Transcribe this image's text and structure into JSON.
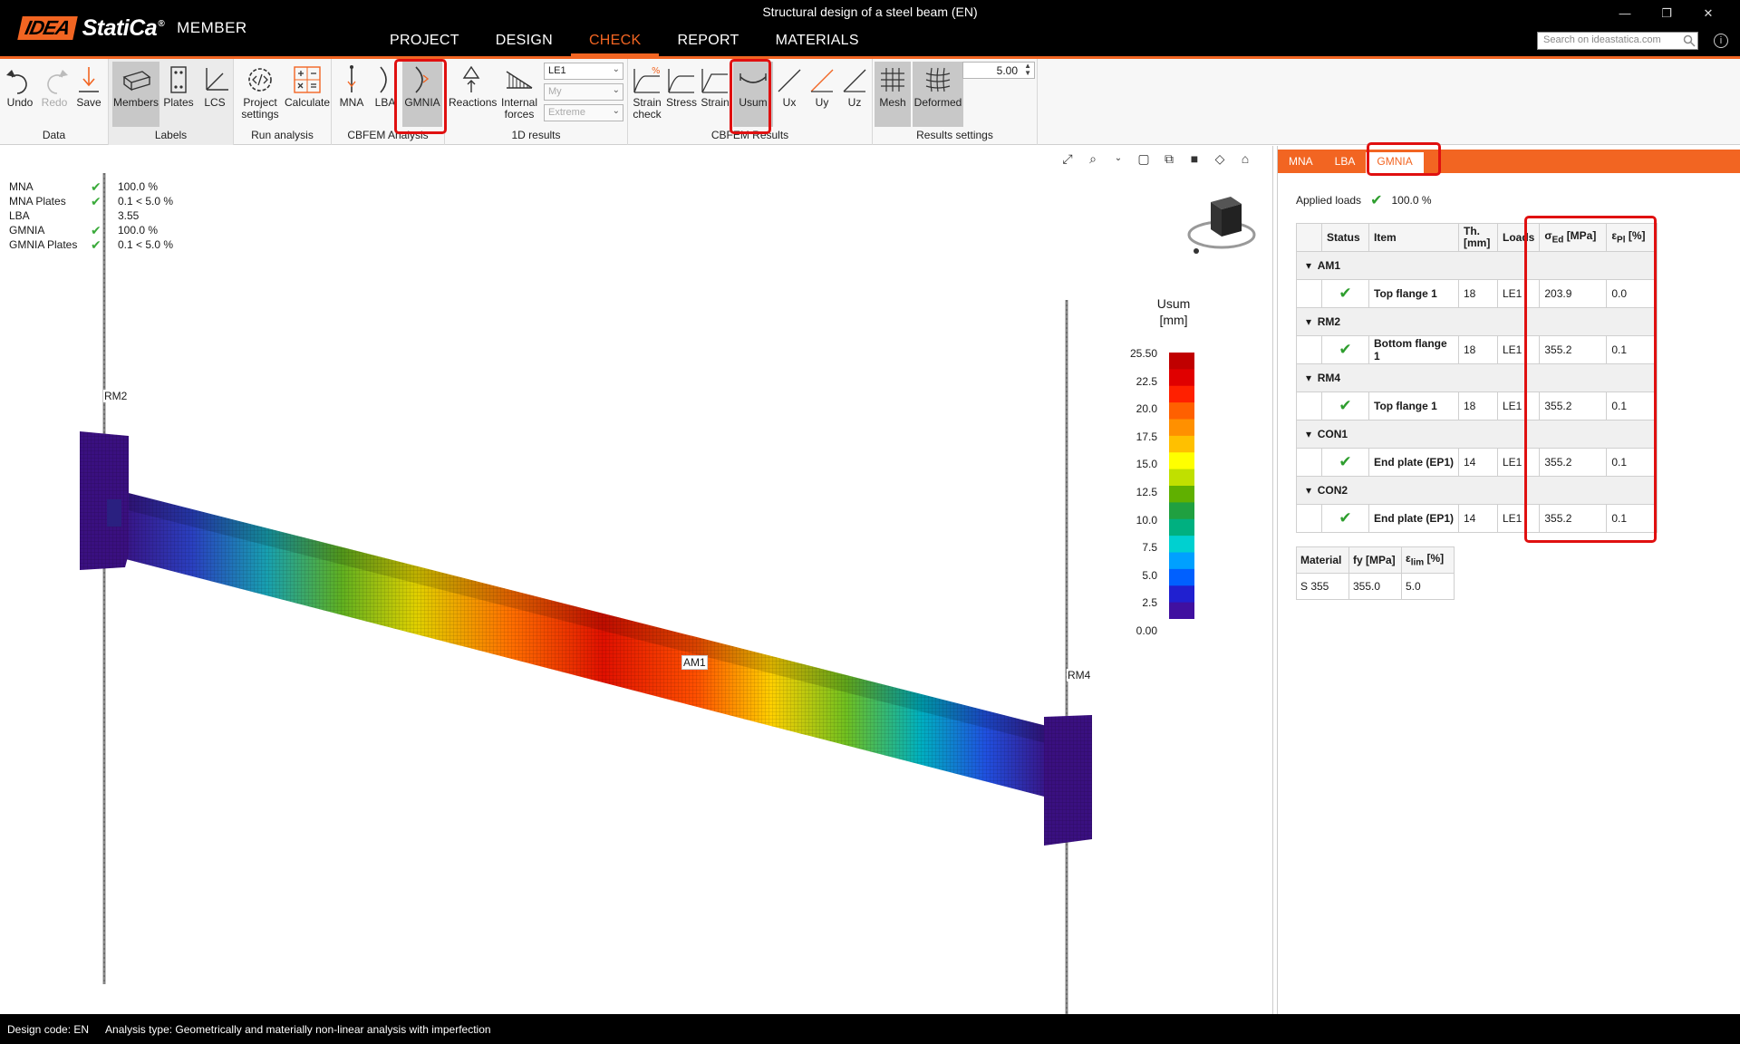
{
  "app": {
    "logo_idea": "IDEA",
    "logo_statica": "StatiCa",
    "logo_reg": "®",
    "logo_member": "MEMBER",
    "window_title": "Structural design of a steel beam (EN)",
    "win_controls": [
      "—",
      "❐",
      "✕"
    ]
  },
  "nav": {
    "tabs": [
      {
        "label": "PROJECT",
        "active": false
      },
      {
        "label": "DESIGN",
        "active": false
      },
      {
        "label": "CHECK",
        "active": true
      },
      {
        "label": "REPORT",
        "active": false
      },
      {
        "label": "MATERIALS",
        "active": false
      }
    ],
    "search_placeholder": "Search on ideastatica.com",
    "info": "i"
  },
  "ribbon": {
    "data_group": {
      "label": "Data",
      "undo": "Undo",
      "redo": "Redo",
      "save": "Save"
    },
    "labels_group": {
      "label": "Labels",
      "members": "Members",
      "plates": "Plates",
      "lcs": "LCS"
    },
    "run_group": {
      "label": "Run analysis",
      "project_settings": "Project settings",
      "calculate": "Calculate"
    },
    "cbfem_analysis": {
      "label": "CBFEM Analysis",
      "mna": "MNA",
      "lba": "LBA",
      "gmnia": "GMNIA"
    },
    "results_1d": {
      "label": "1D results",
      "reactions": "Reactions",
      "internal_forces": "Internal forces",
      "combo_load": "LE1",
      "combo_component": "My",
      "combo_mode": "Extreme"
    },
    "cbfem_results": {
      "label": "CBFEM Results",
      "strain_check": "Strain check",
      "stress": "Stress",
      "strain": "Strain",
      "usum": "Usum",
      "ux": "Ux",
      "uy": "Uy",
      "uz": "Uz"
    },
    "results_settings": {
      "label": "Results settings",
      "mesh": "Mesh",
      "deformed": "Deformed",
      "scale": "5.00"
    }
  },
  "summary": [
    {
      "name": "MNA",
      "check": true,
      "value": "100.0 %"
    },
    {
      "name": "MNA Plates",
      "check": true,
      "value": "0.1 < 5.0 %"
    },
    {
      "name": "LBA",
      "check": false,
      "value": "3.55"
    },
    {
      "name": "GMNIA",
      "check": true,
      "value": "100.0 %"
    },
    {
      "name": "GMNIA Plates",
      "check": true,
      "value": "0.1 < 5.0 %"
    }
  ],
  "legend": {
    "title": "Usum",
    "unit": "[mm]",
    "ticks": [
      "25.50",
      "22.5",
      "20.0",
      "17.5",
      "15.0",
      "12.5",
      "10.0",
      "7.5",
      "5.0",
      "2.5",
      "0.00"
    ],
    "colors": [
      "#c00000",
      "#e00000",
      "#ff2000",
      "#ff6000",
      "#ff9000",
      "#ffc000",
      "#ffff00",
      "#c0e000",
      "#60b000",
      "#20a040",
      "#00b080",
      "#00d0d0",
      "#00a0ff",
      "#0060ff",
      "#2020d0",
      "#4010a0"
    ]
  },
  "members": {
    "rm2": "RM2",
    "am1": "AM1",
    "rm4": "RM4"
  },
  "panel": {
    "tabs": [
      {
        "label": "MNA",
        "active": false
      },
      {
        "label": "LBA",
        "active": false
      },
      {
        "label": "GMNIA",
        "active": true
      }
    ],
    "applied_label": "Applied loads",
    "applied_value": "100.0 %",
    "table_headers": {
      "status": "Status",
      "item": "Item",
      "th": "Th.",
      "th_unit": "[mm]",
      "loads": "Loads",
      "sigma": "σ",
      "sigma_sub": "Ed",
      "sigma_unit": "[MPa]",
      "eps": "ε",
      "eps_sub": "Pl",
      "eps_unit": "[%]"
    },
    "groups": [
      {
        "name": "AM1",
        "item": "Top flange 1",
        "th": "18",
        "loads": "LE1",
        "sigma": "203.9",
        "eps": "0.0"
      },
      {
        "name": "RM2",
        "item": "Bottom flange 1",
        "th": "18",
        "loads": "LE1",
        "sigma": "355.2",
        "eps": "0.1"
      },
      {
        "name": "RM4",
        "item": "Top flange 1",
        "th": "18",
        "loads": "LE1",
        "sigma": "355.2",
        "eps": "0.1"
      },
      {
        "name": "CON1",
        "item": "End plate (EP1)",
        "th": "14",
        "loads": "LE1",
        "sigma": "355.2",
        "eps": "0.1"
      },
      {
        "name": "CON2",
        "item": "End plate (EP1)",
        "th": "14",
        "loads": "LE1",
        "sigma": "355.2",
        "eps": "0.1"
      }
    ],
    "material_headers": {
      "material": "Material",
      "fy": "fy [MPa]",
      "eps": "ε",
      "eps_sub": "lim",
      "eps_unit": "[%]"
    },
    "material_row": {
      "material": "S 355",
      "fy": "355.0",
      "eps": "5.0"
    }
  },
  "status": {
    "design_code": "Design code: EN",
    "analysis_type": "Analysis type: Geometrically and materially non-linear analysis with imperfection"
  }
}
